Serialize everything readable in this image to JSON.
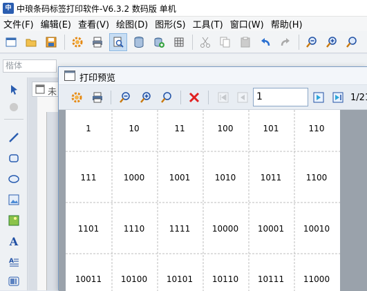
{
  "app": {
    "title": "中琅条码标签打印软件-V6.3.2 数码版 单机",
    "icon_label": "中"
  },
  "menu": [
    "文件(F)",
    "编辑(E)",
    "查看(V)",
    "绘图(D)",
    "图形(S)",
    "工具(T)",
    "窗口(W)",
    "帮助(H)"
  ],
  "toolbar": {
    "icons": [
      "new-icon",
      "open-icon",
      "save-icon",
      "sep",
      "settings-icon",
      "print-icon",
      "print-preview-icon",
      "database-icon",
      "add-data-icon",
      "grid-icon",
      "sep",
      "cut-icon",
      "copy-icon",
      "paste-icon",
      "undo-icon",
      "redo-icon",
      "sep",
      "zoom-out-icon",
      "zoom-in-icon",
      "zoom-fit-icon"
    ]
  },
  "fontbar": {
    "font_placeholder": "楷体"
  },
  "document": {
    "tab_label": "未"
  },
  "preview": {
    "title": "打印预览",
    "page_value": "1",
    "page_total": "1/21",
    "rows": [
      [
        "1",
        "10",
        "11",
        "100",
        "101",
        "110"
      ],
      [
        "111",
        "1000",
        "1001",
        "1010",
        "1011",
        "1100"
      ],
      [
        "1101",
        "1110",
        "1111",
        "10000",
        "10001",
        "10010"
      ],
      [
        "10011",
        "10100",
        "10101",
        "10110",
        "10111",
        "11000"
      ]
    ]
  },
  "colors": {
    "accent": "#2a5db0",
    "close_red": "#e02020",
    "dialog_border": "#7a9cc4"
  }
}
